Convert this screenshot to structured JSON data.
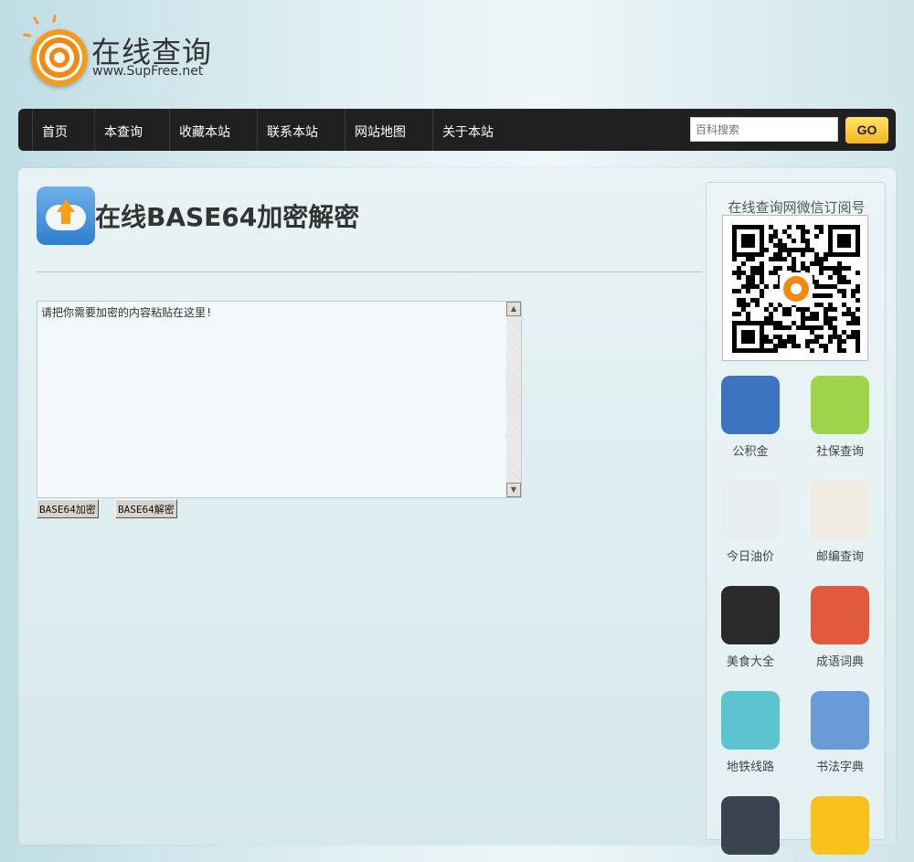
{
  "logo": {
    "title": "在线查询",
    "url": "www.SupFree.net"
  },
  "nav": {
    "items": [
      "首页",
      "本查询",
      "收藏本站",
      "联系本站",
      "网站地图",
      "关于本站"
    ],
    "search_placeholder": "百科搜索",
    "go": "GO"
  },
  "main": {
    "title": "在线BASE64加密解密",
    "textarea_value": "请把你需要加密的内容粘贴在这里!",
    "encode": "BASE64加密",
    "decode": "BASE64解密"
  },
  "sidebar": {
    "title": "在线查询网微信订阅号",
    "apps": [
      {
        "label": "公积金",
        "color": "#3d74c2"
      },
      {
        "label": "社保查询",
        "color": "#9fd44a"
      },
      {
        "label": "今日油价",
        "color": "#e8eef0"
      },
      {
        "label": "邮编查询",
        "color": "#f1ece2"
      },
      {
        "label": "美食大全",
        "color": "#2a2a2a"
      },
      {
        "label": "成语词典",
        "color": "#e25a3e"
      },
      {
        "label": "地铁线路",
        "color": "#5bc4cf"
      },
      {
        "label": "书法字典",
        "color": "#6a9ad8"
      },
      {
        "label": "",
        "color": "#3a4350"
      },
      {
        "label": "",
        "color": "#f7c21a"
      }
    ]
  }
}
